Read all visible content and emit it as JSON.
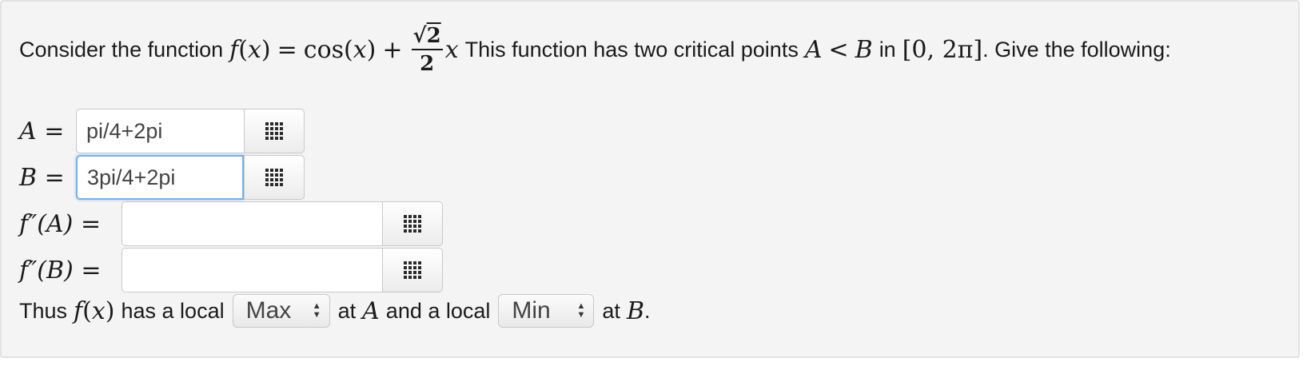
{
  "problem": {
    "intro": "Consider the function",
    "f": "f",
    "x": "x",
    "eq": "=",
    "cos": "cos",
    "plus": "+",
    "sqrt_num": "2",
    "frac_den": "2",
    "desc1": "This function has two critical points",
    "A": "A",
    "lt": "<",
    "B": "B",
    "in": "in",
    "interval": "[0, 2π]",
    "desc2": ". Give the following:"
  },
  "fields": {
    "A": {
      "label": "A",
      "value": "pi/4+2pi"
    },
    "B": {
      "label": "B",
      "value": "3pi/4+2pi"
    },
    "fppA": {
      "label": "f″(A)",
      "value": ""
    },
    "fppB": {
      "label": "f″(B)",
      "value": ""
    }
  },
  "conclusion": {
    "thus": "Thus",
    "has_local": "has a local",
    "select1": "Max",
    "at": "at",
    "and_local": "and a local",
    "select2": "Min",
    "at2": "at",
    "period": "."
  },
  "icons": {
    "palette": "grid-icon",
    "select_arrows": "up-down-arrows-icon"
  }
}
